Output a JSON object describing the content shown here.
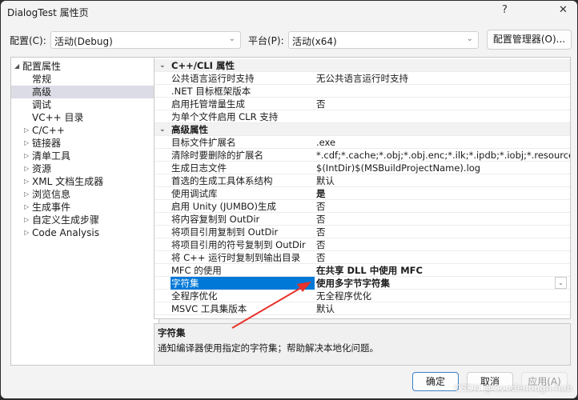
{
  "window": {
    "title": "DialogTest 属性页",
    "help": "?",
    "close": "✕"
  },
  "config": {
    "config_label": "配置(C):",
    "config_value": "活动(Debug)",
    "platform_label": "平台(P):",
    "platform_value": "活动(x64)",
    "manager_button": "配置管理器(O)..."
  },
  "tree": [
    {
      "label": "配置属性",
      "level": 0,
      "expander": "expanded"
    },
    {
      "label": "常规",
      "level": 1
    },
    {
      "label": "高级",
      "level": 1,
      "selected": true
    },
    {
      "label": "调试",
      "level": 1
    },
    {
      "label": "VC++ 目录",
      "level": 1
    },
    {
      "label": "C/C++",
      "level": 1,
      "expander": "collapsed"
    },
    {
      "label": "链接器",
      "level": 1,
      "expander": "collapsed"
    },
    {
      "label": "清单工具",
      "level": 1,
      "expander": "collapsed"
    },
    {
      "label": "资源",
      "level": 1,
      "expander": "collapsed"
    },
    {
      "label": "XML 文档生成器",
      "level": 1,
      "expander": "collapsed"
    },
    {
      "label": "浏览信息",
      "level": 1,
      "expander": "collapsed"
    },
    {
      "label": "生成事件",
      "level": 1,
      "expander": "collapsed"
    },
    {
      "label": "自定义生成步骤",
      "level": 1,
      "expander": "collapsed"
    },
    {
      "label": "Code Analysis",
      "level": 1,
      "expander": "collapsed"
    }
  ],
  "grid": [
    {
      "category": true,
      "name": "C++/CLI 属性"
    },
    {
      "name": "公共语言运行时支持",
      "value": "无公共语言运行时支持"
    },
    {
      "name": ".NET 目标框架版本",
      "value": ""
    },
    {
      "name": "启用托管增量生成",
      "value": "否"
    },
    {
      "name": "为单个文件启用 CLR 支持",
      "value": ""
    },
    {
      "category": true,
      "name": "高级属性"
    },
    {
      "name": "目标文件扩展名",
      "value": ".exe"
    },
    {
      "name": "清除时要删除的扩展名",
      "value": "*.cdf;*.cache;*.obj;*.obj.enc;*.ilk;*.ipdb;*.iobj;*.resources;*.tlb;*"
    },
    {
      "name": "生成日志文件",
      "value": "$(IntDir)$(MSBuildProjectName).log"
    },
    {
      "name": "首选的生成工具体系结构",
      "value": "默认"
    },
    {
      "name": "使用调试库",
      "value": "是",
      "bold": true
    },
    {
      "name": "启用 Unity (JUMBO)生成",
      "value": "否"
    },
    {
      "name": "将内容复制到 OutDir",
      "value": "否"
    },
    {
      "name": "将项目引用复制到 OutDir",
      "value": "否"
    },
    {
      "name": "将项目引用的符号复制到 OutDir",
      "value": "否"
    },
    {
      "name": "将 C++ 运行时复制到输出目录",
      "value": "否"
    },
    {
      "name": "MFC 的使用",
      "value": "在共享 DLL 中使用 MFC",
      "bold": true
    },
    {
      "name": "字符集",
      "value": "使用多字节字符集",
      "bold": true,
      "selected": true
    },
    {
      "name": "全程序优化",
      "value": "无全程序优化"
    },
    {
      "name": "MSVC 工具集版本",
      "value": "默认"
    }
  ],
  "description": {
    "title": "字符集",
    "text": "通知编译器使用指定的字符集；帮助解决本地化问题。"
  },
  "buttons": {
    "ok": "确定",
    "cancel": "取消",
    "apply": "应用(A)"
  },
  "watermark": "CSDN @Goodenough-hub",
  "colors": {
    "selection": "#0078d7",
    "annotation_arrow": "#e8322a"
  }
}
